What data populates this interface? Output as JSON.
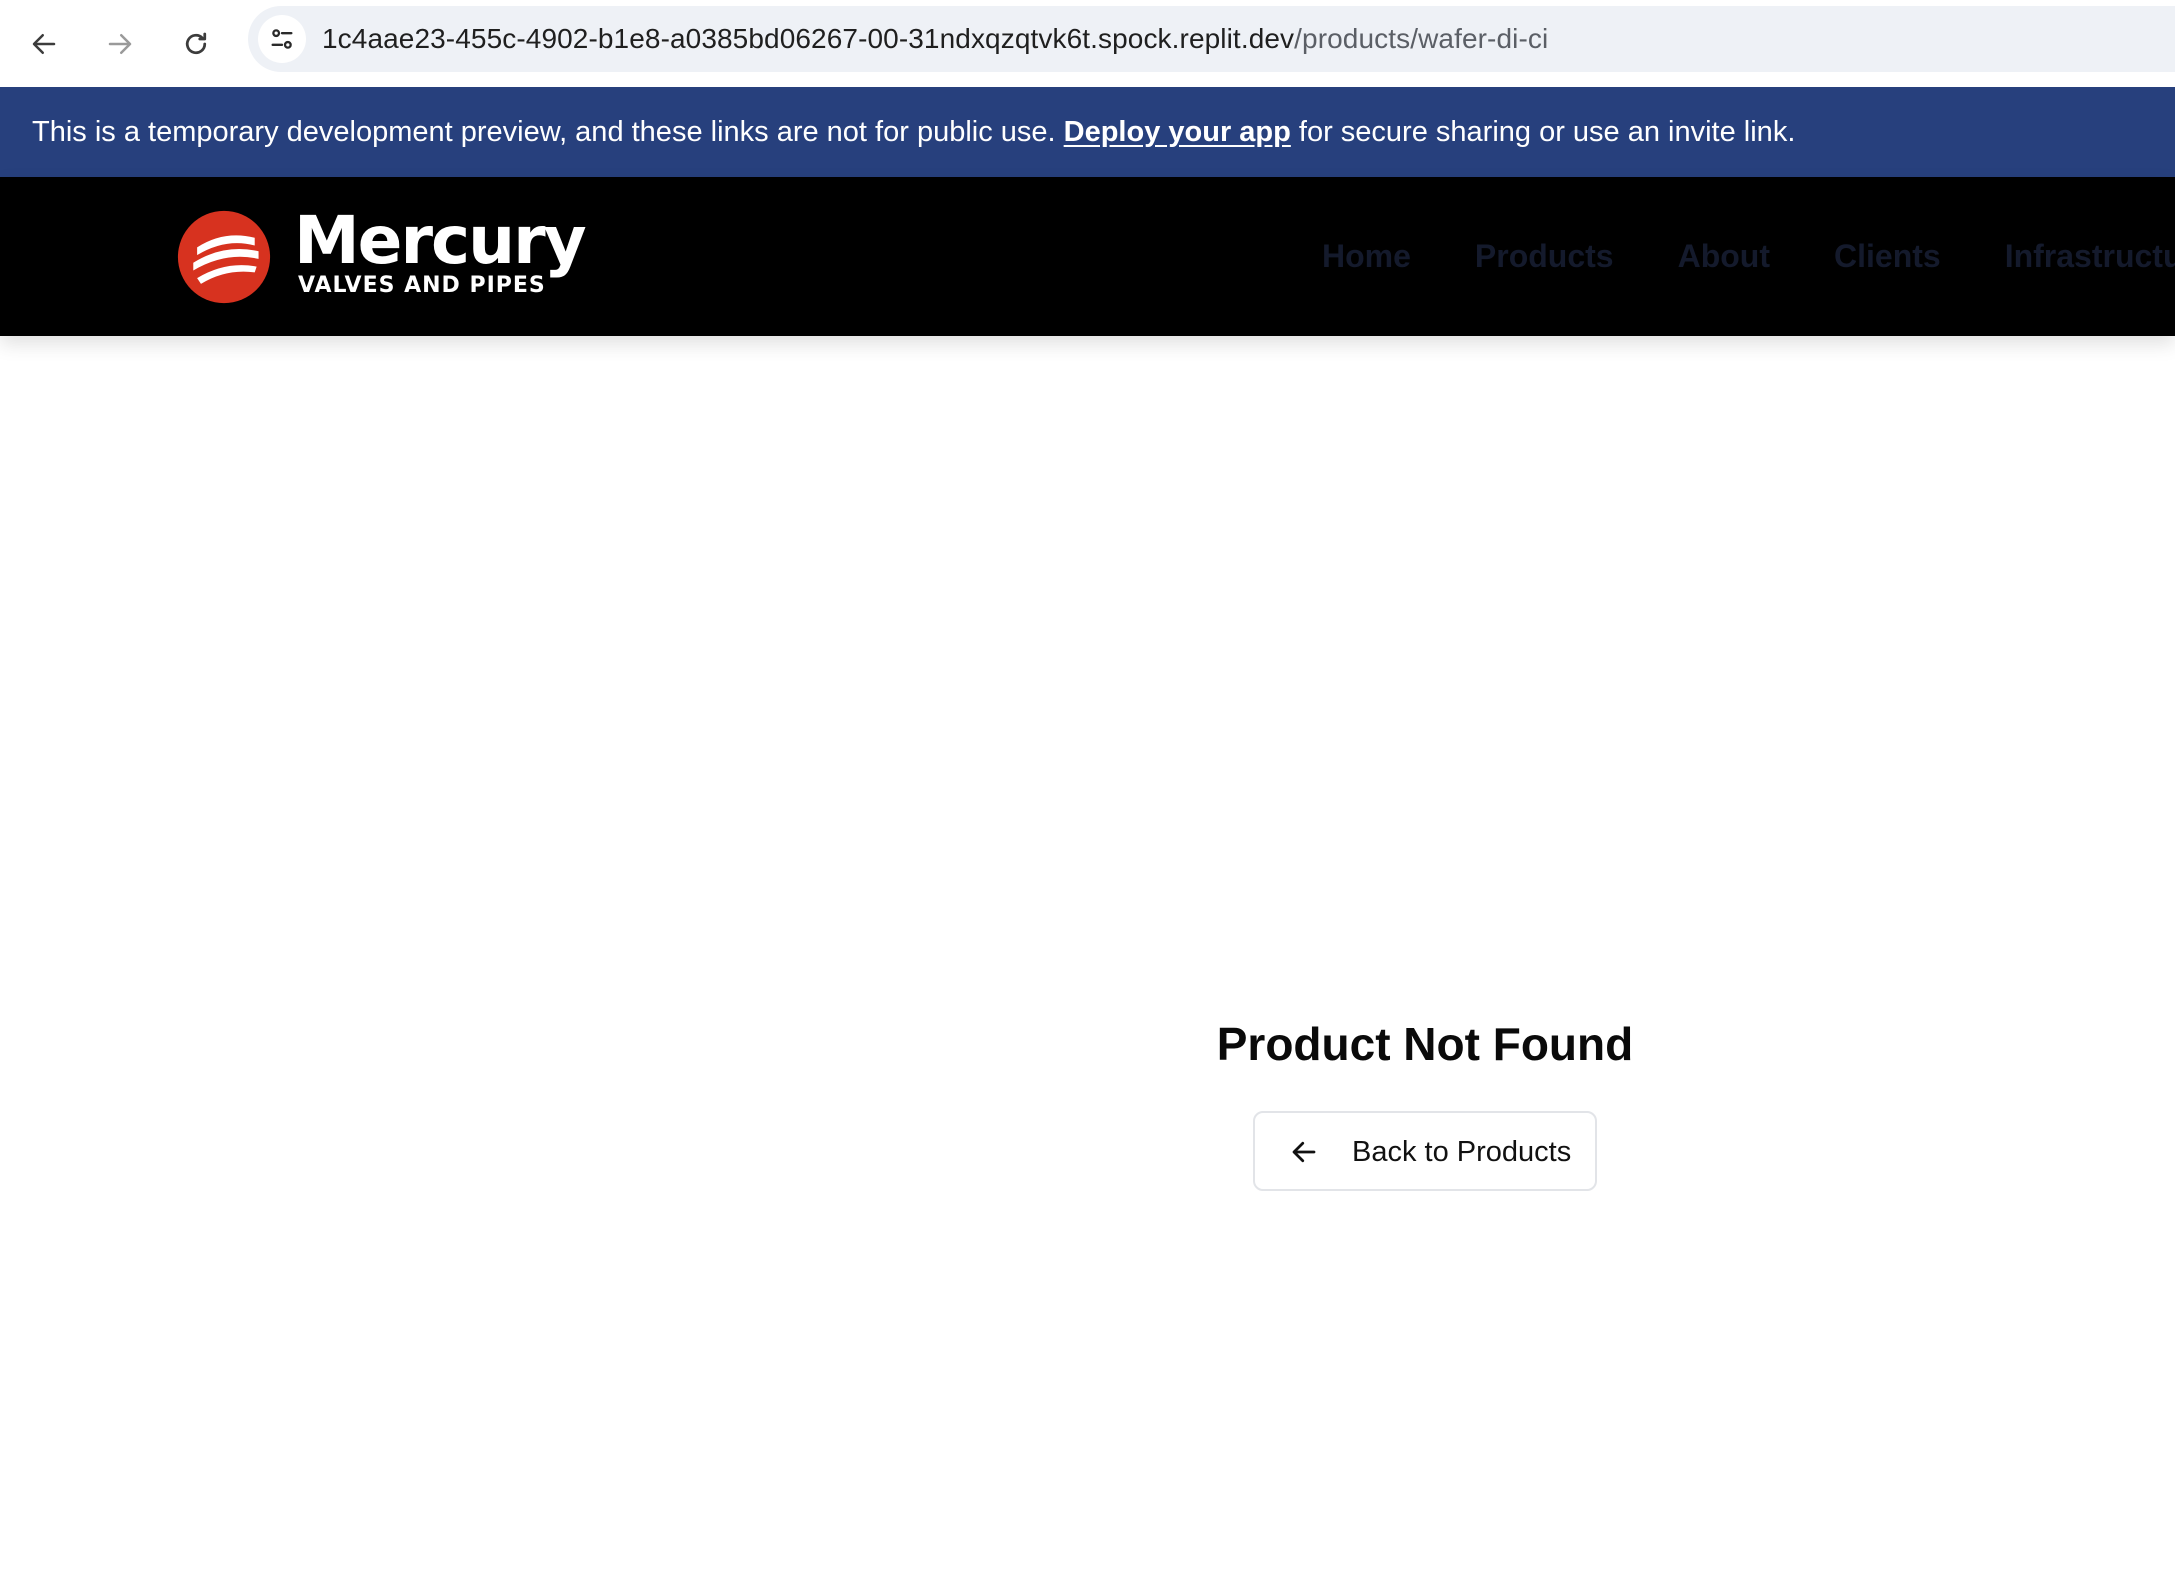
{
  "browser": {
    "url_host": "1c4aae23-455c-4902-b1e8-a0385bd06267-00-31ndxqzqtvk6t.spock.replit.dev",
    "url_path": "/products/wafer-di-ci"
  },
  "banner": {
    "text_before": "This is a temporary development preview, and these links are not for public use. ",
    "link_label": "Deploy your app",
    "text_after": " for secure sharing or use an invite link."
  },
  "header": {
    "logo_word": "Mercury",
    "logo_sub": "VALVES AND PIPES",
    "nav": [
      "Home",
      "Products",
      "About",
      "Clients",
      "Infrastructure"
    ]
  },
  "main": {
    "title": "Product Not Found",
    "back_label": "Back to Products"
  },
  "colors": {
    "banner_bg": "#27407d",
    "header_bg": "#000000",
    "logo_red": "#d7321f"
  }
}
